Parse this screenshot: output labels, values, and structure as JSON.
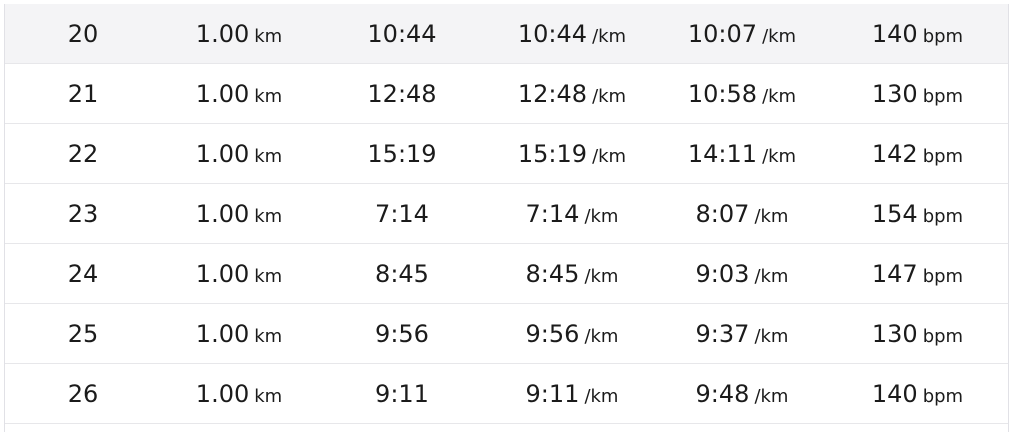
{
  "splits": [
    {
      "split": "20",
      "distance": "1.00",
      "distance_unit": "km",
      "time": "10:44",
      "pace": "10:44",
      "pace_unit": "/km",
      "gap": "10:07",
      "gap_unit": "/km",
      "heart_rate": "140",
      "hr_unit": "bpm"
    },
    {
      "split": "21",
      "distance": "1.00",
      "distance_unit": "km",
      "time": "12:48",
      "pace": "12:48",
      "pace_unit": "/km",
      "gap": "10:58",
      "gap_unit": "/km",
      "heart_rate": "130",
      "hr_unit": "bpm"
    },
    {
      "split": "22",
      "distance": "1.00",
      "distance_unit": "km",
      "time": "15:19",
      "pace": "15:19",
      "pace_unit": "/km",
      "gap": "14:11",
      "gap_unit": "/km",
      "heart_rate": "142",
      "hr_unit": "bpm"
    },
    {
      "split": "23",
      "distance": "1.00",
      "distance_unit": "km",
      "time": "7:14",
      "pace": "7:14",
      "pace_unit": "/km",
      "gap": "8:07",
      "gap_unit": "/km",
      "heart_rate": "154",
      "hr_unit": "bpm"
    },
    {
      "split": "24",
      "distance": "1.00",
      "distance_unit": "km",
      "time": "8:45",
      "pace": "8:45",
      "pace_unit": "/km",
      "gap": "9:03",
      "gap_unit": "/km",
      "heart_rate": "147",
      "hr_unit": "bpm"
    },
    {
      "split": "25",
      "distance": "1.00",
      "distance_unit": "km",
      "time": "9:56",
      "pace": "9:56",
      "pace_unit": "/km",
      "gap": "9:37",
      "gap_unit": "/km",
      "heart_rate": "130",
      "hr_unit": "bpm"
    },
    {
      "split": "26",
      "distance": "1.00",
      "distance_unit": "km",
      "time": "9:11",
      "pace": "9:11",
      "pace_unit": "/km",
      "gap": "9:48",
      "gap_unit": "/km",
      "heart_rate": "140",
      "hr_unit": "bpm"
    }
  ],
  "colors": {
    "highlight_row": "#f4f4f6",
    "text": "#1b1b1b",
    "divider": "#e7e7ea"
  }
}
